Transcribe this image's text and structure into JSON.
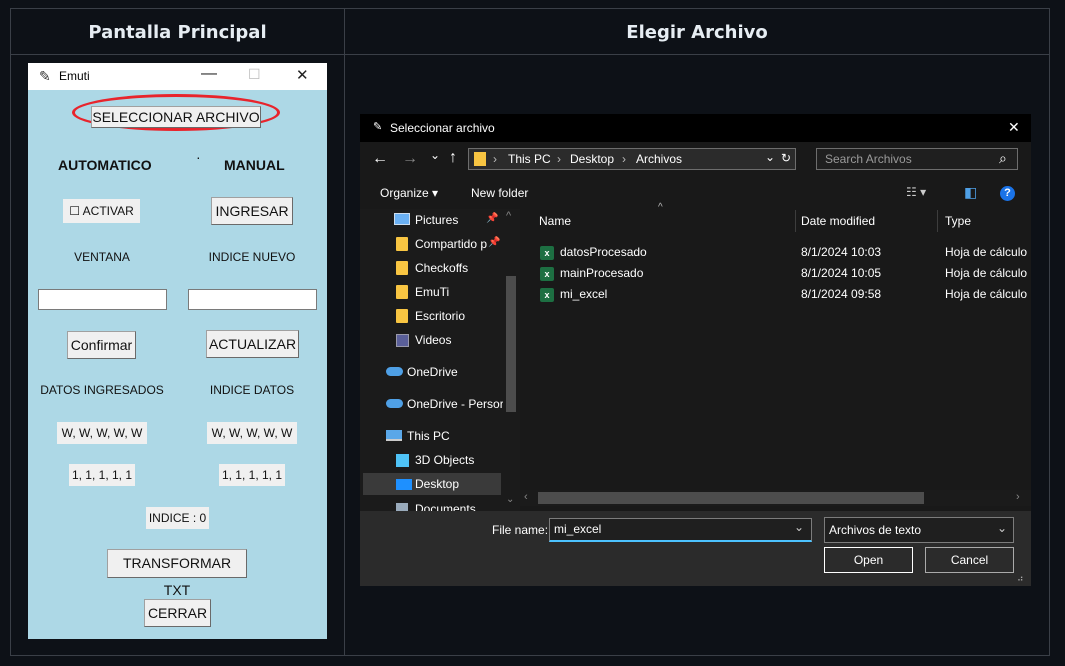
{
  "headers": {
    "left": "Pantalla Principal",
    "right": "Elegir Archivo"
  },
  "tk": {
    "title": "Emuti",
    "controls": {
      "minimize": "—",
      "maximize": "☐",
      "close": "✕"
    },
    "select_file": "SELECCIONAR ARCHIVO",
    "automatic": "AUTOMATICO",
    "manual": "MANUAL",
    "dot": "·",
    "activate_check": "☐",
    "activate_label": "ACTIVAR",
    "ingresar": "INGRESAR",
    "ventana": "VENTANA",
    "indice_nuevo": "INDICE NUEVO",
    "confirmar": "Confirmar",
    "actualizar": "ACTUALIZAR",
    "datos_ingresados": "DATOS INGRESADOS",
    "indice_datos": "INDICE DATOS",
    "w_left": "W, W, W, W, W",
    "w_right": "W, W, W, W, W",
    "ones_left": "1, 1, 1, 1, 1",
    "ones_right": "1, 1, 1, 1, 1",
    "indice": "INDICE : 0",
    "transformar": "TRANSFORMAR TXT",
    "cerrar": "CERRAR"
  },
  "dialog": {
    "title": "Seleccionar archivo",
    "close": "✕",
    "nav": {
      "back": "←",
      "forward": "→",
      "recent": "⌄",
      "up": "↑"
    },
    "breadcrumb": [
      "This PC",
      "Desktop",
      "Archivos"
    ],
    "crumb_sep": "›",
    "address_dropdown": "⌄",
    "refresh": "↻",
    "search_placeholder": "Search Archivos",
    "search_icon": "⌕",
    "organize": "Organize ▾",
    "new_folder": "New folder",
    "view_icon": "☷ ▾",
    "pane_icon": "◧",
    "help_icon": "?",
    "sidebar": [
      {
        "label": "Pictures",
        "icon": "pictures-icon",
        "pin": "📌"
      },
      {
        "label": "Compartido p",
        "icon": "folder-icon",
        "pin": "📌"
      },
      {
        "label": "Checkoffs",
        "icon": "folder-icon"
      },
      {
        "label": "EmuTi",
        "icon": "folder-icon"
      },
      {
        "label": "Escritorio",
        "icon": "folder-icon"
      },
      {
        "label": "Videos",
        "icon": "videos-icon"
      },
      {
        "label": "OneDrive",
        "icon": "cloud-icon"
      },
      {
        "label": "OneDrive - Persor",
        "icon": "cloud-icon"
      },
      {
        "label": "This PC",
        "icon": "pc-icon"
      },
      {
        "label": "3D Objects",
        "icon": "cube-icon"
      },
      {
        "label": "Desktop",
        "icon": "desktop-icon"
      },
      {
        "label": "Documents",
        "icon": "documents-icon"
      }
    ],
    "columns": [
      "Name",
      "Date modified",
      "Type"
    ],
    "sort_indicator": "^",
    "files": [
      {
        "name": "datosProcesado",
        "date": "8/1/2024 10:03",
        "type": "Hoja de cálculo"
      },
      {
        "name": "mainProcesado",
        "date": "8/1/2024 10:05",
        "type": "Hoja de cálculo"
      },
      {
        "name": "mi_excel",
        "date": "8/1/2024 09:58",
        "type": "Hoja de cálculo"
      }
    ],
    "file_name_label": "File name:",
    "file_name_value": "mi_excel",
    "file_type": "Archivos de texto",
    "open": "Open",
    "cancel": "Cancel"
  },
  "colors": {
    "tk_bg": "#add8e6",
    "highlight_ellipse": "#e8242c",
    "dialog_bg": "#191919",
    "excel_green": "#1d6f42",
    "folder_yellow": "#f8c542",
    "onedrive_blue": "#4fa0e6"
  }
}
